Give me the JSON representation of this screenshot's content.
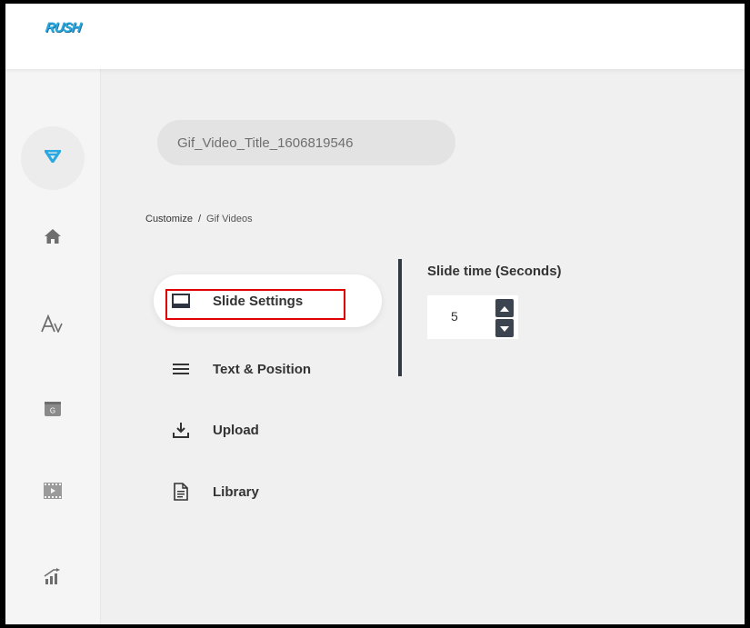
{
  "app": {
    "logo_text": "RUSH"
  },
  "sidebar": {
    "items": [
      {
        "icon": "brand-v-icon"
      },
      {
        "icon": "home-icon"
      },
      {
        "icon": "font-icon"
      },
      {
        "icon": "gif-icon"
      },
      {
        "icon": "video-icon"
      },
      {
        "icon": "analytics-icon"
      }
    ]
  },
  "main": {
    "title": "Gif_Video_Title_1606819546",
    "breadcrumb": {
      "root": "Customize",
      "separator": "/",
      "current": "Gif Videos"
    },
    "nav": [
      {
        "label": "Slide Settings",
        "icon": "slideshow-icon",
        "active": true
      },
      {
        "label": "Text & Position",
        "icon": "menu-lines-icon"
      },
      {
        "label": "Upload",
        "icon": "download-icon"
      },
      {
        "label": "Library",
        "icon": "document-icon"
      }
    ],
    "slide_time": {
      "label": "Slide time (Seconds)",
      "value": "5"
    }
  },
  "colors": {
    "accent": "#2aa8e0",
    "highlight": "#e00000",
    "dark": "#3c4450"
  }
}
